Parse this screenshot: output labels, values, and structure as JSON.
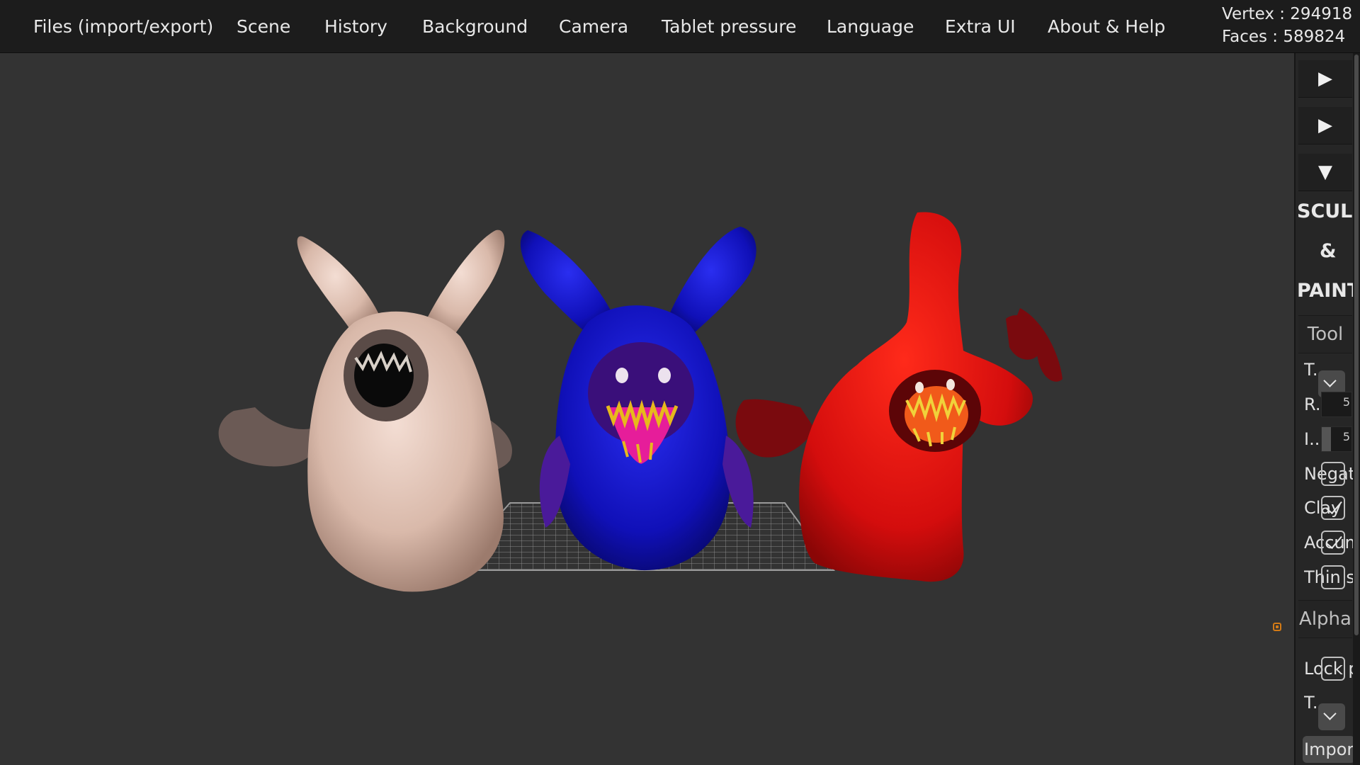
{
  "menu": {
    "items": [
      "Files (import/export)",
      "Scene",
      "History",
      "Background",
      "Camera",
      "Tablet pressure",
      "Language",
      "Extra UI",
      "About & Help"
    ]
  },
  "stats": {
    "vertex": "Vertex : 294918",
    "faces": "Faces : 589824"
  },
  "panel": {
    "fold_buttons": [
      "▶",
      "▶",
      "▼"
    ],
    "main_title_line1": "SCULPT",
    "main_title_line2": "&",
    "main_title_line3": "PAINT",
    "tool_section": "Tool",
    "tool_rows": {
      "tool": "T...",
      "radius": "R...",
      "radius_value": "5",
      "intensity": "I...",
      "intensity_value": "5",
      "negative": "Negative",
      "clay": "Clay",
      "accumulate": "Accumulate",
      "thin": "Thin s"
    },
    "alpha_section": "Alpha",
    "alpha_rows": {
      "lock": "Lock p",
      "type": "T...",
      "import": "Import"
    },
    "state": {
      "radius_fill": 0.0,
      "intensity_fill": 0.3,
      "negative_checked": false,
      "clay_checked": true,
      "accumulate_checked": true,
      "thin_checked": false,
      "lock_checked": false
    }
  },
  "colors": {
    "menubar_bg": "#1c1c1c",
    "viewport_bg": "#333333",
    "panel_bg": "#262626",
    "gizmo": "#d27a16"
  }
}
